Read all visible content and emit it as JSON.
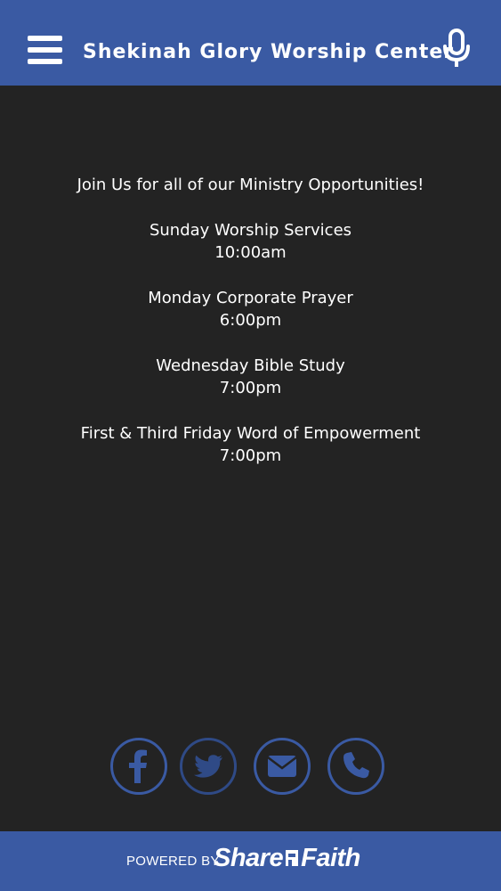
{
  "header": {
    "title": "Shekinah Glory Worship Center",
    "menu_icon": "hamburger-menu-icon",
    "mic_icon": "microphone-icon",
    "background": "#3a5aa3"
  },
  "main": {
    "intro": "Join Us for all of our Ministry Opportunities!",
    "events": [
      {
        "name": "Sunday Worship Services",
        "time": "10:00am"
      },
      {
        "name": "Monday Corporate Prayer",
        "time": "6:00pm"
      },
      {
        "name": "Wednesday Bible Study",
        "time": "7:00pm"
      },
      {
        "name": "First & Third Friday Word of Empowerment",
        "time": "7:00pm"
      }
    ]
  },
  "social": {
    "icons": [
      "facebook-icon",
      "twitter-icon",
      "email-icon",
      "phone-icon"
    ],
    "color": "#3a5aa3"
  },
  "footer": {
    "powered_by": "POWERED BY",
    "brand_left": "Share",
    "brand_right": "Faith"
  }
}
